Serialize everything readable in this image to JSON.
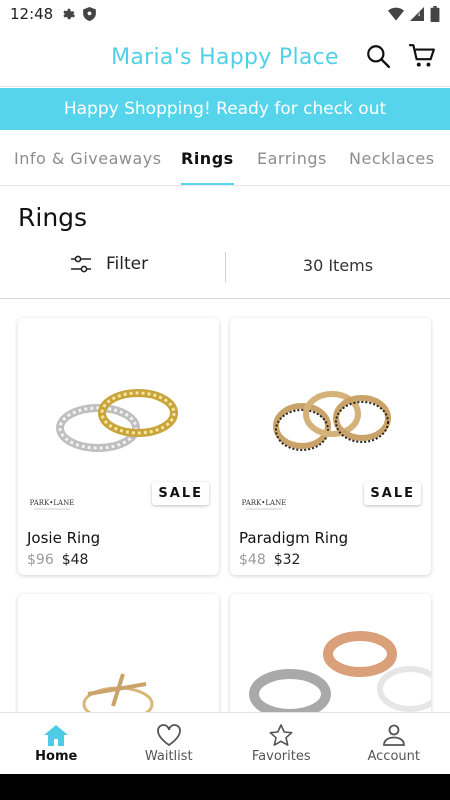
{
  "status_bar": {
    "time": "12:48"
  },
  "header": {
    "title": "Maria's Happy Place"
  },
  "banner": {
    "text": "Happy Shopping! Ready for check out"
  },
  "tabs": [
    {
      "label": "Info & Giveaways",
      "active": false
    },
    {
      "label": "Rings",
      "active": true
    },
    {
      "label": "Earrings",
      "active": false
    },
    {
      "label": "Necklaces",
      "active": false
    }
  ],
  "section": {
    "title": "Rings"
  },
  "filter": {
    "label": "Filter",
    "count": "30 Items"
  },
  "products": [
    {
      "name": "Josie Ring",
      "old_price": "$96",
      "new_price": "$48",
      "badge": "SALE",
      "image": "silver-gold-eternity-rings"
    },
    {
      "name": "Paradigm Ring",
      "old_price": "$48",
      "new_price": "$32",
      "badge": "SALE",
      "image": "gold-stacked-band-rings"
    },
    {
      "name": "",
      "image": "gold-cross-ring"
    },
    {
      "name": "",
      "image": "silver-rose-gold-bands"
    }
  ],
  "bottom_nav": [
    {
      "label": "Home",
      "icon": "home-icon",
      "active": true
    },
    {
      "label": "Waitlist",
      "icon": "heart-icon",
      "active": false
    },
    {
      "label": "Favorites",
      "icon": "star-icon",
      "active": false
    },
    {
      "label": "Account",
      "icon": "person-icon",
      "active": false
    }
  ],
  "colors": {
    "accent": "#56d4ec",
    "title": "#4fd0e8"
  }
}
